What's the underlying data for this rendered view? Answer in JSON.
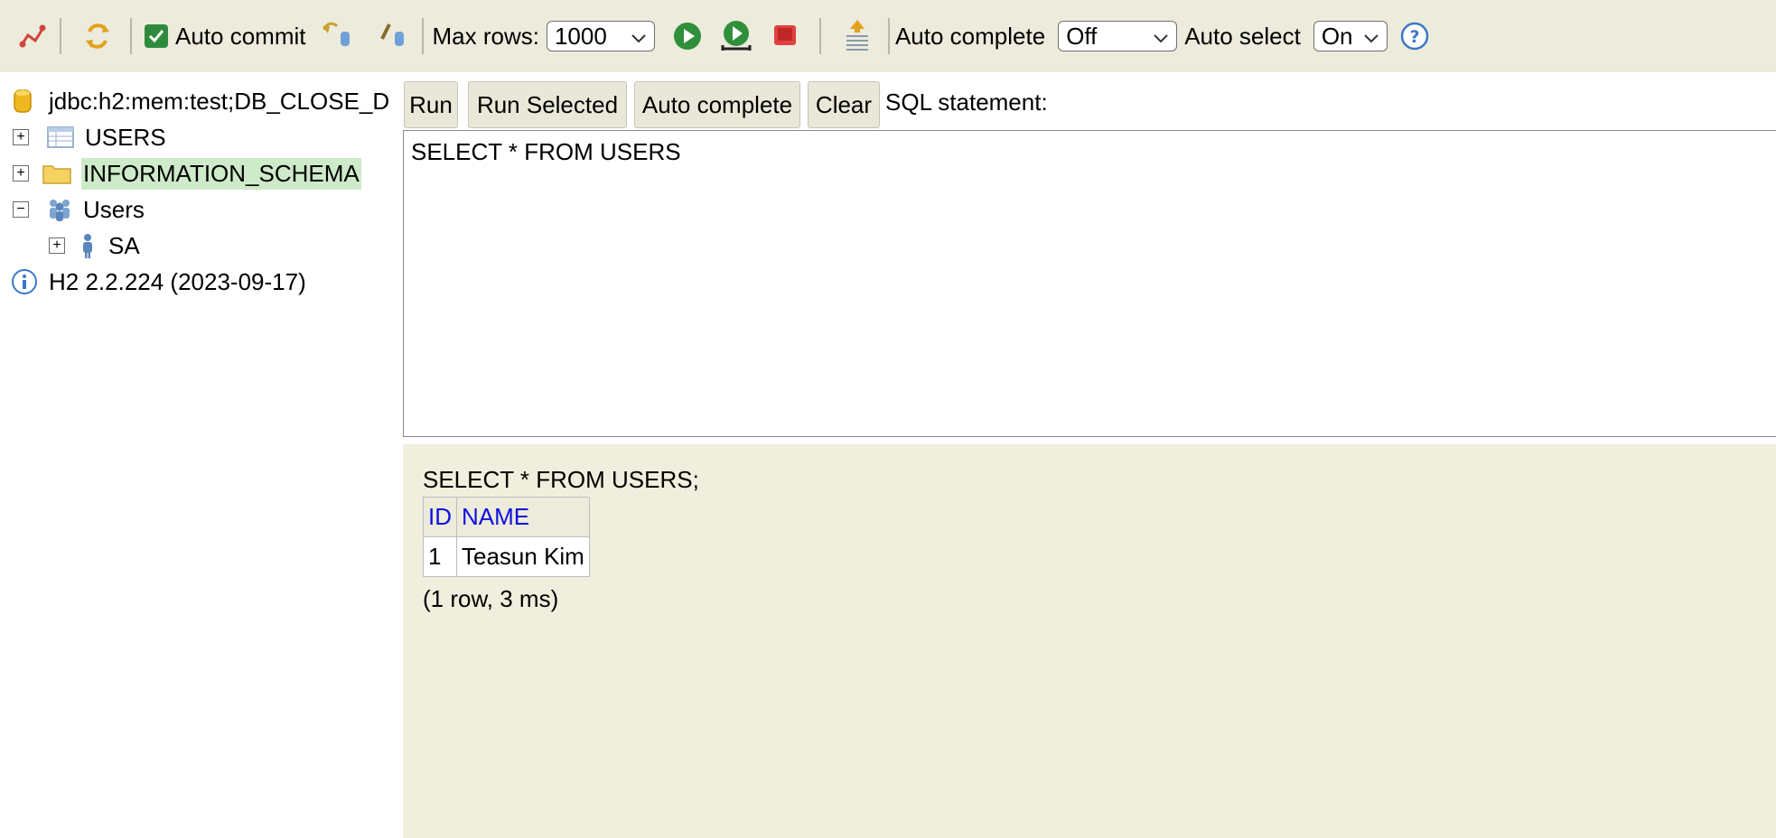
{
  "toolbar": {
    "auto_commit_label": "Auto commit",
    "max_rows_label": "Max rows:",
    "max_rows_value": "1000",
    "auto_complete_label": "Auto complete",
    "auto_complete_value": "Off",
    "auto_select_label": "Auto select",
    "auto_select_value": "On",
    "icons": [
      "disconnect-icon",
      "refresh-icon",
      "auto-commit-checkbox",
      "rollback-icon",
      "commit-icon",
      "run-icon",
      "run-selected-icon",
      "stop-icon",
      "history-icon",
      "help-icon"
    ]
  },
  "tree": {
    "connection": "jdbc:h2:mem:test;DB_CLOSE_D",
    "items": [
      {
        "label": "USERS",
        "expander": "+"
      },
      {
        "label": "INFORMATION_SCHEMA",
        "expander": "+"
      },
      {
        "label": "Users",
        "expander": "−"
      },
      {
        "label": "SA",
        "expander": "+"
      }
    ],
    "version": "H2 2.2.224 (2023-09-17)"
  },
  "buttons": {
    "run": "Run",
    "run_selected": "Run Selected",
    "auto_complete": "Auto complete",
    "clear": "Clear"
  },
  "sql_label": "SQL statement:",
  "editor_text": "SELECT * FROM USERS",
  "results": {
    "statement": "SELECT * FROM USERS;",
    "columns": [
      "ID",
      "NAME"
    ],
    "rows": [
      [
        "1",
        "Teasun Kim"
      ]
    ],
    "info": "(1 row, 3 ms)"
  },
  "colors": {
    "toolbar_bg": "#ecebdc",
    "results_bg": "#f0eedd",
    "header_link": "#1010e0",
    "highlight": "#cdeac9"
  }
}
